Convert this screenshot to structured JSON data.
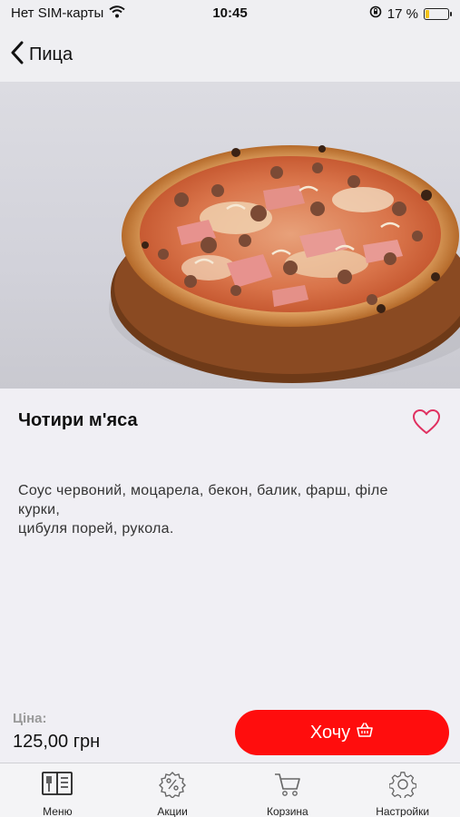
{
  "status_bar": {
    "carrier": "Нет SIM-карты",
    "time": "10:45",
    "battery": "17 %",
    "battery_level": 0.17,
    "icons": [
      "wifi-icon",
      "rotation-lock-icon",
      "battery-icon"
    ]
  },
  "nav": {
    "back_label": "Пица",
    "back_icon": "chevron-left-icon"
  },
  "product": {
    "image": "pizza-photo",
    "name": "Чотири м'яса",
    "description_lines": [
      "Соус червоний, моцарела, бекон, балик, фарш, філе",
      "курки,",
      "цибуля порей, рукола."
    ],
    "favorite_icon": "heart-outline-icon"
  },
  "purchase": {
    "price_label": "Ціна:",
    "price_value": "125,00 грн",
    "button_label": "Хочу",
    "button_icon": "basket-icon"
  },
  "tabs": [
    {
      "label": "Меню",
      "icon": "menu-book-icon"
    },
    {
      "label": "Акции",
      "icon": "percent-gear-icon"
    },
    {
      "label": "Корзина",
      "icon": "cart-icon"
    },
    {
      "label": "Настройки",
      "icon": "gear-icon"
    }
  ],
  "colors": {
    "accent": "#ff0d0d",
    "favorite": "#e03060",
    "background": "#f0eff4"
  }
}
